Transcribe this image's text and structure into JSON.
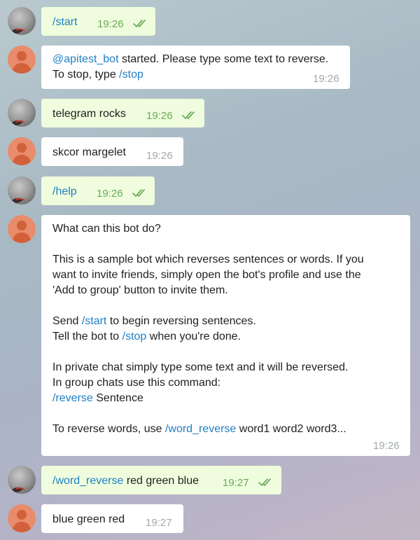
{
  "chat": {
    "messages": [
      {
        "id": "m1",
        "direction": "outgoing",
        "segments": [
          {
            "text": "/start",
            "is_command": true
          }
        ],
        "time": "19:26",
        "status": "read"
      },
      {
        "id": "m2",
        "direction": "incoming",
        "line1": [
          {
            "text": "@apitest_bot",
            "is_command": true
          },
          {
            "text": " started. Please type some text to reverse.",
            "is_command": false
          }
        ],
        "line2": [
          {
            "text": "To stop, type ",
            "is_command": false
          },
          {
            "text": "/stop",
            "is_command": true
          }
        ],
        "time": "19:26"
      },
      {
        "id": "m3",
        "direction": "outgoing",
        "segments": [
          {
            "text": "telegram rocks",
            "is_command": false
          }
        ],
        "time": "19:26",
        "status": "read"
      },
      {
        "id": "m4",
        "direction": "incoming",
        "segments": [
          {
            "text": "skcor margelet",
            "is_command": false
          }
        ],
        "time": "19:26"
      },
      {
        "id": "m5",
        "direction": "outgoing",
        "segments": [
          {
            "text": "/help",
            "is_command": true
          }
        ],
        "time": "19:26",
        "status": "read"
      },
      {
        "id": "m6",
        "direction": "incoming",
        "heading": "What can this bot do?",
        "description": [
          "This is a sample bot which reverses sentences or words. If you",
          "want to invite friends, simply open the bot's profile and use the",
          "'Add to group' button to invite them."
        ],
        "send_prefix": "Send ",
        "send_cmd": "/start",
        "send_suffix": " to begin reversing sentences.",
        "tell_prefix": "Tell the bot to ",
        "tell_cmd": "/stop",
        "tell_suffix": " when you're done.",
        "private_line": "In private chat simply type some text and it will be reversed.",
        "group_line": "In group chats use this command:",
        "reverse_cmd": "/reverse",
        "reverse_arg": " Sentence",
        "words_prefix": "To reverse words, use ",
        "words_cmd": "/word_reverse",
        "words_suffix": " word1 word2 word3...",
        "time": "19:26"
      },
      {
        "id": "m7",
        "direction": "outgoing",
        "segments": [
          {
            "text": "/word_reverse",
            "is_command": true
          },
          {
            "text": " red green blue",
            "is_command": false
          }
        ],
        "time": "19:27",
        "status": "read"
      },
      {
        "id": "m8",
        "direction": "incoming",
        "segments": [
          {
            "text": "blue green red",
            "is_command": false
          }
        ],
        "time": "19:27"
      }
    ]
  },
  "colors": {
    "outgoing_bubble": "#effdde",
    "incoming_bubble": "#ffffff",
    "command_link": "#1f7fc3",
    "outgoing_time": "#6aaa57",
    "incoming_time": "#a2a8ad",
    "bot_avatar": "#e88c6b",
    "user_avatar": "#8d8d8d"
  }
}
